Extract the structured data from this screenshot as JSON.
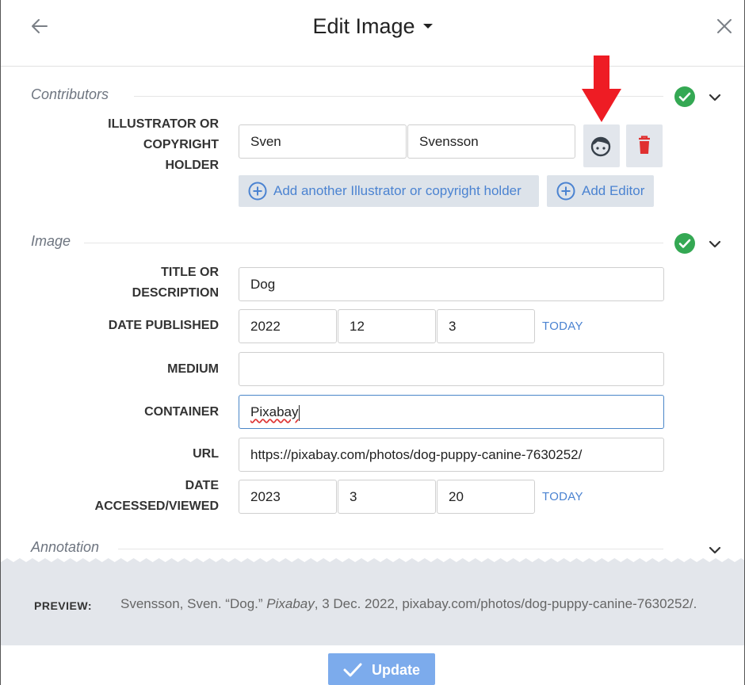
{
  "header": {
    "title": "Edit Image"
  },
  "sections": {
    "contributors": "Contributors",
    "image": "Image",
    "annotation": "Annotation"
  },
  "contributors": {
    "label_line1": "ILLUSTRATOR OR",
    "label_line2": "COPYRIGHT",
    "label_line3": "HOLDER",
    "first_name": "Sven",
    "last_name": "Svensson",
    "add_contributor": "Add another Illustrator or copyright holder",
    "add_editor": "Add Editor"
  },
  "image": {
    "title_label_1": "TITLE OR",
    "title_label_2": "DESCRIPTION",
    "title_value": "Dog",
    "date_published_label": "DATE PUBLISHED",
    "date_published": {
      "year": "2022",
      "month": "12",
      "day": "3"
    },
    "today_label": "TODAY",
    "medium_label": "MEDIUM",
    "medium_value": "",
    "container_label": "CONTAINER",
    "container_value": "Pixabay",
    "url_label": "URL",
    "url_value": "https://pixabay.com/photos/dog-puppy-canine-7630252/",
    "accessed_label_1": "DATE",
    "accessed_label_2": "ACCESSED/VIEWED",
    "date_accessed": {
      "year": "2023",
      "month": "3",
      "day": "20"
    }
  },
  "preview": {
    "label": "PREVIEW:",
    "text_before": "Svensson, Sven. “Dog.” ",
    "text_italic": "Pixabay",
    "text_after": ", 3 Dec. 2022, pixabay.com/photos/dog-puppy-canine-7630252/."
  },
  "footer": {
    "update_label": "Update"
  },
  "colors": {
    "accent_blue": "#4b83d1",
    "check_green": "#34a853",
    "delete_red": "#e03030",
    "arrow_red": "#ee1c24",
    "update_button": "#7cabec"
  }
}
